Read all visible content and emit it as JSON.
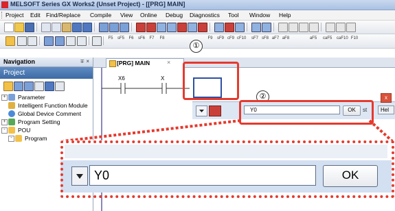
{
  "window": {
    "title": "MELSOFT Series GX Works2 (Unset Project) - [[PRG] MAIN]"
  },
  "menu": [
    "Project",
    "Edit",
    "Find/Replace",
    "Compile",
    "View",
    "Online",
    "Debug",
    "Diagnostics",
    "Tool",
    "Window",
    "Help"
  ],
  "function_keys": [
    "F5",
    "sF5",
    "F6",
    "sF6",
    "F7",
    "F8",
    "F9",
    "sF9",
    "cF9",
    "cF10",
    "sF7",
    "sF8",
    "aF7",
    "aF8",
    "aF5",
    "caF5",
    "caF10",
    "F10"
  ],
  "navigation": {
    "title": "Navigation",
    "pin": "∓ ×",
    "project_label": "Project",
    "tree": [
      "Parameter",
      "Intelligent Function Module",
      "Global Device Comment",
      "Program Setting",
      "POU",
      "Program"
    ]
  },
  "editor": {
    "tab_label": "[PRG] MAIN",
    "tab_close": "×",
    "contacts": [
      "X6",
      "X"
    ]
  },
  "search_dialog": {
    "input_value": "Y0",
    "ok_label": "OK",
    "fragment_text": "st",
    "help_label": "Hel",
    "close_glyph": "x"
  },
  "zoom": {
    "input_value": "Y0",
    "ok_label": "OK"
  },
  "callouts": {
    "one": "①",
    "two": "②"
  },
  "colors": {
    "callout": "#e53a2e",
    "title_bar": "#b8cde9",
    "project_bar": "#4d79b3",
    "ladder_line": "#3a3a8c"
  }
}
